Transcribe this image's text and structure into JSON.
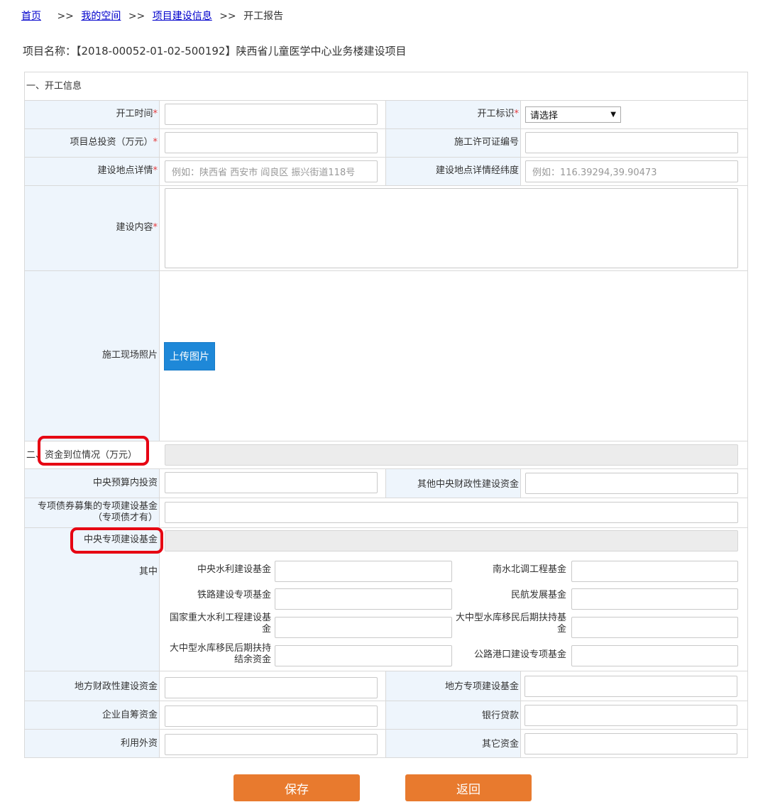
{
  "breadcrumb": {
    "home": "首页",
    "sep": ">>",
    "space": "我的空间",
    "info": "项目建设信息",
    "current": "开工报告"
  },
  "project_title": "项目名称：【2018-00052-01-02-500192】陕西省儿童医学中心业务楼建设项目",
  "sections": {
    "start_info": "一、开工信息",
    "funds": "二、资金到位情况（万元）"
  },
  "labels": {
    "start_time": "开工时间",
    "start_flag": "开工标识",
    "total_invest": "项目总投资（万元）",
    "permit_no": "施工许可证编号",
    "location": "建设地点详情",
    "lnglat": "建设地点详情经纬度",
    "content": "建设内容",
    "photos": "施工现场照片",
    "central_budget": "中央预算内投资",
    "other_central": "其他中央财政性建设资金",
    "special_bond_1": "专项债券募集的专项建设基金",
    "special_bond_2": "（专项债才有）",
    "central_special": "中央专项建设基金",
    "among": "其中",
    "water": "中央水利建设基金",
    "south_north": "南水北调工程基金",
    "rail": "铁路建设专项基金",
    "aviation": "民航发展基金",
    "major_water_1": "国家重大水利工程建设基",
    "major_water_2": "金",
    "reservoir_late_1": "大中型水库移民后期扶持基",
    "reservoir_late_2": "金",
    "reservoir_rem_1": "大中型水库移民后期扶持",
    "reservoir_rem_2": "结余资金",
    "road_port": "公路港口建设专项基金",
    "local_fiscal": "地方财政性建设资金",
    "local_special": "地方专项建设基金",
    "self_raised": "企业自筹资金",
    "bank_loan": "银行贷款",
    "foreign": "利用外资",
    "other_funds": "其它资金"
  },
  "required_mark": "*",
  "inputs": {
    "location_placeholder": "例如：陕西省 西安市 阎良区 振兴街道118号",
    "lnglat_placeholder": "例如：116.39294,39.90473"
  },
  "select": {
    "start_flag_value": "请选择",
    "arrow": "▼"
  },
  "buttons": {
    "upload": "上传图片",
    "save": "保存",
    "back": "返回"
  },
  "colors": {
    "label_bg": "#eef5fc",
    "button_orange": "#e87a2e",
    "upload_blue": "#1e88d8",
    "highlight_red": "#e60012",
    "required_red": "#e4393c"
  }
}
